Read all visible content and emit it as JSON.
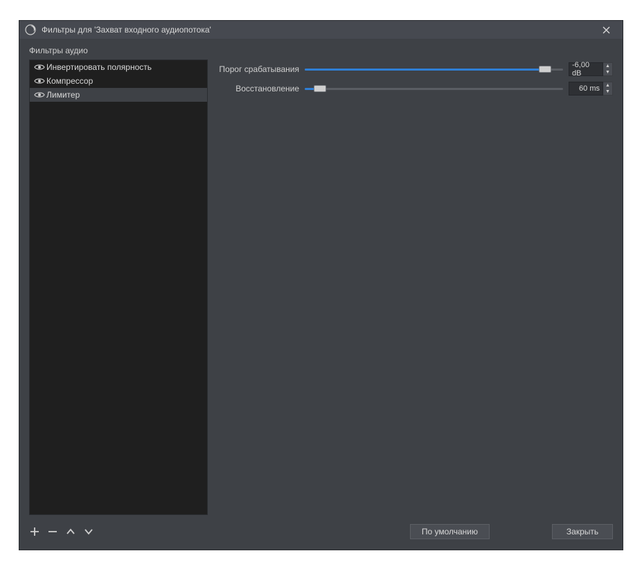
{
  "window": {
    "title": "Фильтры для 'Захват входного аудиопотока'"
  },
  "sidebar": {
    "section_label": "Фильтры аудио",
    "items": [
      {
        "label": "Инвертировать полярность",
        "selected": false
      },
      {
        "label": "Компрессор",
        "selected": false
      },
      {
        "label": "Лимитер",
        "selected": true
      }
    ]
  },
  "properties": {
    "threshold": {
      "label": "Порог срабатывания",
      "value_text": "-6,00 dB",
      "fill_percent": 93,
      "thumb_percent": 93
    },
    "release": {
      "label": "Восстановление",
      "value_text": "60 ms",
      "fill_percent": 6,
      "thumb_percent": 6
    }
  },
  "buttons": {
    "defaults": "По умолчанию",
    "close": "Закрыть"
  }
}
